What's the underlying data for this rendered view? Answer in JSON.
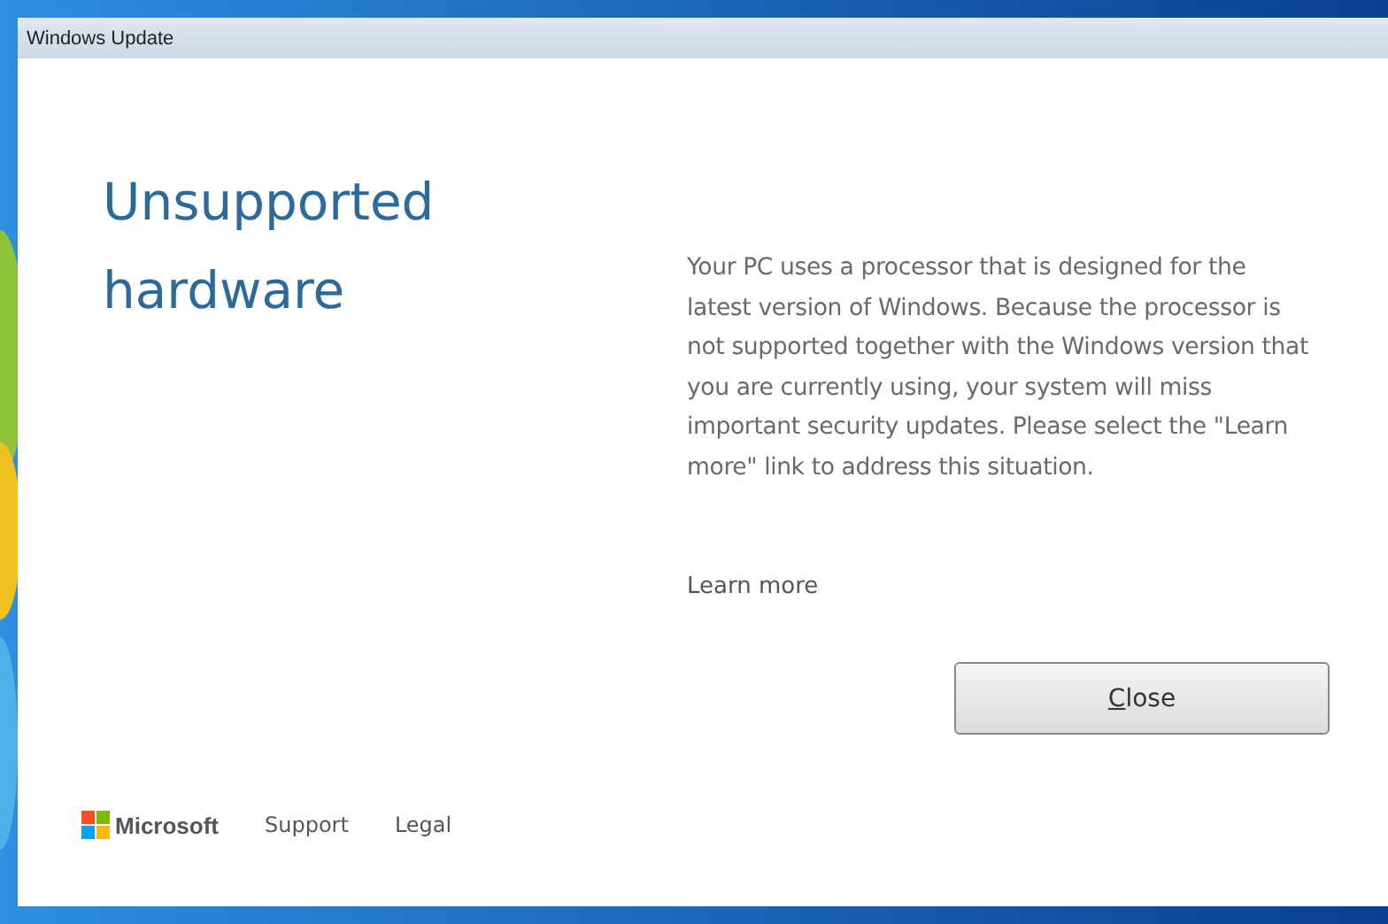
{
  "window": {
    "title": "Windows Update"
  },
  "heading": "Unsupported hardware",
  "message": "Your PC uses a processor that is designed for the latest version of Windows. Because the processor is not supported together with the Windows version that you are currently using, your system will miss important security updates. Please select the \"Learn more\" link to address this situation.",
  "learn_more": "Learn more",
  "buttons": [
    "Close"
  ],
  "footer": {
    "brand": "Microsoft",
    "links": [
      "Support",
      "Legal"
    ]
  }
}
